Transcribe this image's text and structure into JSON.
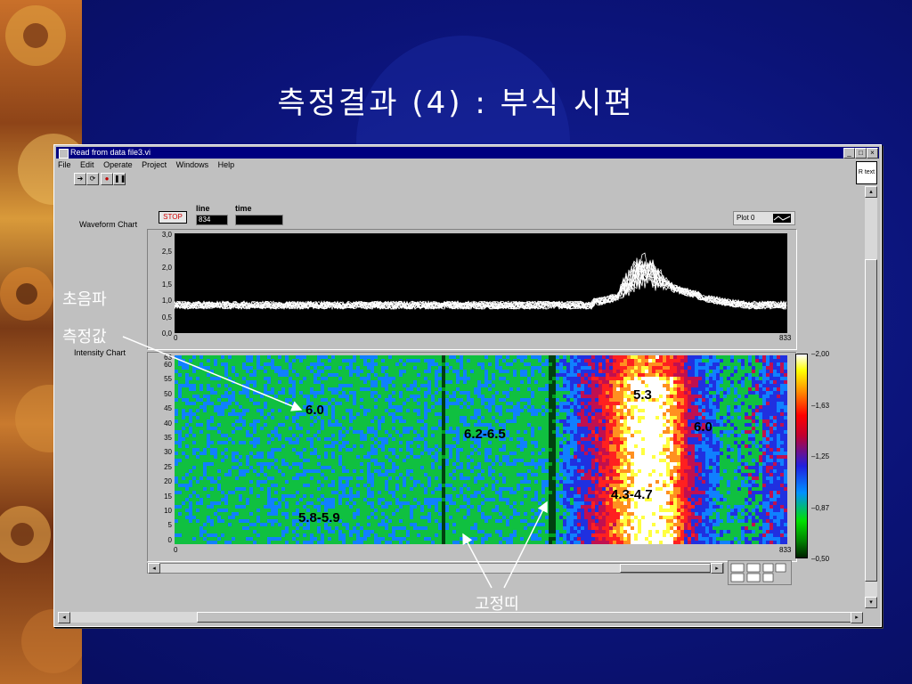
{
  "slide": {
    "title": "측정결과 (4) : 부식 시편",
    "annotations": {
      "ultrasound_line1": "초음파",
      "ultrasound_line2": "측정값",
      "fixed_band": "고정띠"
    }
  },
  "window": {
    "title": "Read from data file3.vi",
    "menu": [
      "File",
      "Edit",
      "Operate",
      "Project",
      "Windows",
      "Help"
    ],
    "rtext_label": "R text"
  },
  "controls": {
    "stop_label": "STOP",
    "line_label": "line",
    "line_value": "834",
    "time_label": "time",
    "time_value": "",
    "plot_legend": "Plot 0"
  },
  "waveform_chart": {
    "label": "Waveform Chart",
    "y_ticks": [
      "3,0",
      "2,5",
      "2,0",
      "1,5",
      "1,0",
      "0,5",
      "0,0"
    ],
    "x_min": "0",
    "x_max": "833"
  },
  "intensity_chart": {
    "label": "Intensity Chart",
    "y_ticks": [
      "63",
      "60",
      "55",
      "50",
      "45",
      "40",
      "35",
      "30",
      "25",
      "20",
      "15",
      "10",
      "5",
      "0"
    ],
    "x_min": "0",
    "x_max": "833",
    "colorbar_ticks": [
      "2,00",
      "1,63",
      "1,25",
      "0,87",
      "0,50"
    ],
    "region_labels": {
      "r1": "6.0",
      "r2": "5.3",
      "r3": "6.2-6.5",
      "r4": "6.0",
      "r5": "4.3-4.7",
      "r6": "5.8-5.9"
    }
  },
  "chart_data": {
    "type": "heatmap",
    "x_range": [
      0,
      833
    ],
    "y_range": [
      0,
      63
    ],
    "z_range": [
      0.5,
      2.0
    ],
    "colorbar": [
      2.0,
      1.63,
      1.25,
      0.87,
      0.5
    ],
    "region_values": [
      {
        "label": "6.0"
      },
      {
        "label": "5.3"
      },
      {
        "label": "6.2-6.5"
      },
      {
        "label": "6.0"
      },
      {
        "label": "4.3-4.7"
      },
      {
        "label": "5.8-5.9"
      }
    ]
  }
}
